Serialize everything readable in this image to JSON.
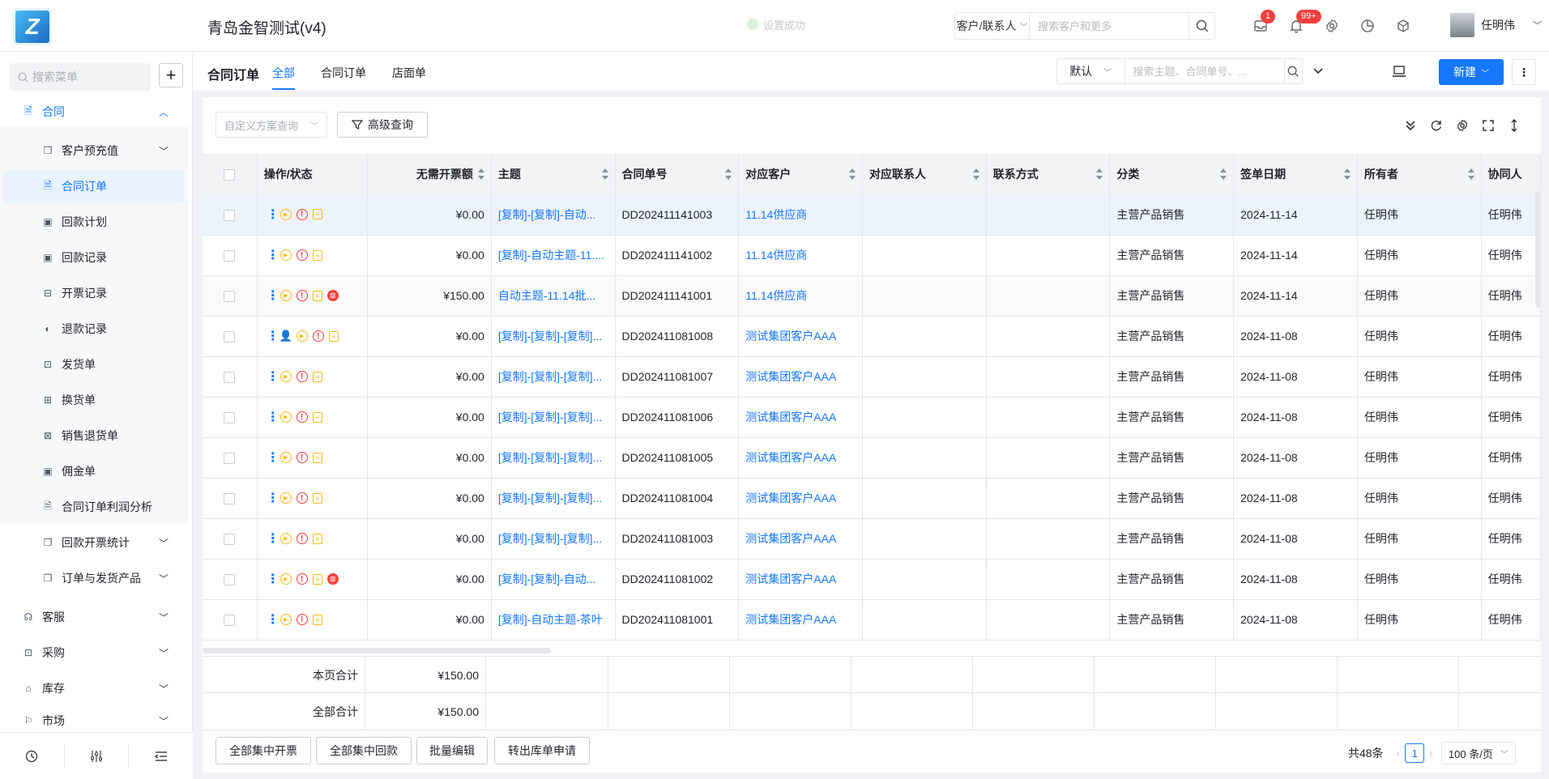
{
  "app": {
    "logo_text": "Z",
    "title": "青岛金智测试(v4)",
    "toast": "设置成功"
  },
  "global_search": {
    "scope": "客户/联系人",
    "placeholder": "搜索客户和更多"
  },
  "header": {
    "message_badge": "1",
    "notify_badge": "99+",
    "user_name": "任明伟"
  },
  "sidebar": {
    "search_placeholder": "搜索菜单",
    "contract": "合同",
    "sub_items": [
      "客户预充值",
      "合同订单",
      "回款计划",
      "回款记录",
      "开票记录",
      "退款记录",
      "发货单",
      "换货单",
      "销售退货单",
      "佣金单",
      "合同订单利润分析",
      "回款开票统计",
      "订单与发货产品"
    ],
    "top_items": [
      "客服",
      "采购",
      "库存",
      "市场"
    ]
  },
  "page": {
    "title": "合同订单",
    "tabs": [
      "全部",
      "合同订单",
      "店面单"
    ],
    "view_select": "默认",
    "search_placeholder": "搜索主题、合同单号、...",
    "new_button": "新建",
    "custom_query_placeholder": "自定义方案查询",
    "advanced_query": "高级查询"
  },
  "table": {
    "columns": [
      "操作/状态",
      "无需开票额",
      "主题",
      "合同单号",
      "对应客户",
      "对应联系人",
      "联系方式",
      "分类",
      "签单日期",
      "所有者",
      "协同人"
    ],
    "rows": [
      {
        "amount": "¥0.00",
        "subject": "[复制]-[复制]-自动...",
        "order_no": "DD202411141003",
        "customer": "11.14供应商",
        "category": "主营产品销售",
        "date": "2024-11-14",
        "owner": "任明伟",
        "collab": "任明伟"
      },
      {
        "amount": "¥0.00",
        "subject": "[复制]-自动主题-11....",
        "order_no": "DD202411141002",
        "customer": "11.14供应商",
        "category": "主营产品销售",
        "date": "2024-11-14",
        "owner": "任明伟",
        "collab": "任明伟"
      },
      {
        "amount": "¥150.00",
        "subject": "自动主题-11.14批...",
        "order_no": "DD202411141001",
        "customer": "11.14供应商",
        "category": "主营产品销售",
        "date": "2024-11-14",
        "owner": "任明伟",
        "collab": "任明伟"
      },
      {
        "amount": "¥0.00",
        "subject": "[复制]-[复制]-[复制]...",
        "order_no": "DD202411081008",
        "customer": "测试集团客户AAA",
        "category": "主营产品销售",
        "date": "2024-11-08",
        "owner": "任明伟",
        "collab": "任明伟"
      },
      {
        "amount": "¥0.00",
        "subject": "[复制]-[复制]-[复制]...",
        "order_no": "DD202411081007",
        "customer": "测试集团客户AAA",
        "category": "主营产品销售",
        "date": "2024-11-08",
        "owner": "任明伟",
        "collab": "任明伟"
      },
      {
        "amount": "¥0.00",
        "subject": "[复制]-[复制]-[复制]...",
        "order_no": "DD202411081006",
        "customer": "测试集团客户AAA",
        "category": "主营产品销售",
        "date": "2024-11-08",
        "owner": "任明伟",
        "collab": "任明伟"
      },
      {
        "amount": "¥0.00",
        "subject": "[复制]-[复制]-[复制]...",
        "order_no": "DD202411081005",
        "customer": "测试集团客户AAA",
        "category": "主营产品销售",
        "date": "2024-11-08",
        "owner": "任明伟",
        "collab": "任明伟"
      },
      {
        "amount": "¥0.00",
        "subject": "[复制]-[复制]-[复制]...",
        "order_no": "DD202411081004",
        "customer": "测试集团客户AAA",
        "category": "主营产品销售",
        "date": "2024-11-08",
        "owner": "任明伟",
        "collab": "任明伟"
      },
      {
        "amount": "¥0.00",
        "subject": "[复制]-[复制]-[复制]...",
        "order_no": "DD202411081003",
        "customer": "测试集团客户AAA",
        "category": "主营产品销售",
        "date": "2024-11-08",
        "owner": "任明伟",
        "collab": "任明伟"
      },
      {
        "amount": "¥0.00",
        "subject": "[复制]-[复制]-自动...",
        "order_no": "DD202411081002",
        "customer": "测试集团客户AAA",
        "category": "主营产品销售",
        "date": "2024-11-08",
        "owner": "任明伟",
        "collab": "任明伟"
      },
      {
        "amount": "¥0.00",
        "subject": "[复制]-自动主题-茶叶",
        "order_no": "DD202411081001",
        "customer": "测试集团客户AAA",
        "category": "主营产品销售",
        "date": "2024-11-08",
        "owner": "任明伟",
        "collab": "任明伟"
      }
    ],
    "row_icons": [
      [
        "more",
        "play",
        "warn",
        "doc"
      ],
      [
        "more",
        "play",
        "warn",
        "doc"
      ],
      [
        "more",
        "play",
        "warn",
        "doc",
        "stamp"
      ],
      [
        "more",
        "user",
        "play",
        "warn",
        "doc"
      ],
      [
        "more",
        "play",
        "warn",
        "doc"
      ],
      [
        "more",
        "play",
        "warn",
        "doc"
      ],
      [
        "more",
        "play",
        "warn",
        "doc"
      ],
      [
        "more",
        "play",
        "warn",
        "doc"
      ],
      [
        "more",
        "play",
        "warn",
        "doc"
      ],
      [
        "more",
        "play",
        "warn",
        "doc",
        "stamp"
      ],
      [
        "more",
        "play",
        "warn",
        "doc"
      ]
    ],
    "page_total_label": "本页合计",
    "page_total": "¥150.00",
    "all_total_label": "全部合计",
    "all_total": "¥150.00"
  },
  "footer": {
    "buttons": [
      "全部集中开票",
      "全部集中回款",
      "批量编辑",
      "转出库单申请"
    ],
    "total": "共48条",
    "page": "1",
    "page_size": "100 条/页"
  },
  "colors": {
    "accent": "#1677ff",
    "danger": "#f53f3f",
    "warning": "#f7ba1e"
  }
}
